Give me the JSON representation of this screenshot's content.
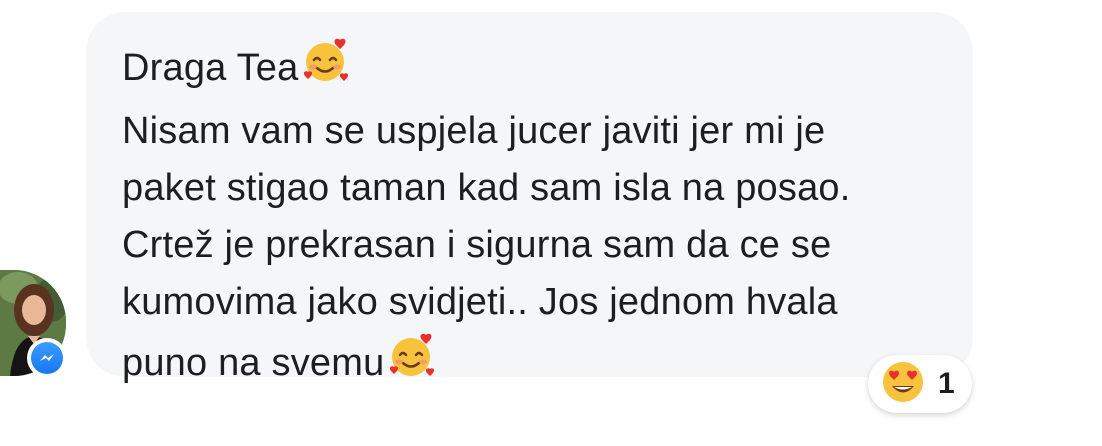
{
  "message": {
    "lines": [
      "Draga Tea",
      "Nisam vam se uspjela jucer javiti jer mi je",
      "paket stigao taman kad sam isla na posao.",
      "Crtež je prekrasan i sigurna sam da ce se",
      "kumovima jako svidjeti.. Jos jednom hvala",
      "puno na svemu"
    ],
    "inline_emoji": "smiling-face-with-hearts",
    "bubble_color": "#f5f6f8",
    "text_color": "#1c1e21"
  },
  "reaction": {
    "emoji": "heart-eyes",
    "count": "1"
  },
  "sender": {
    "avatar": "profile-photo",
    "badge": "messenger-icon",
    "badge_color": "#1877f2"
  }
}
